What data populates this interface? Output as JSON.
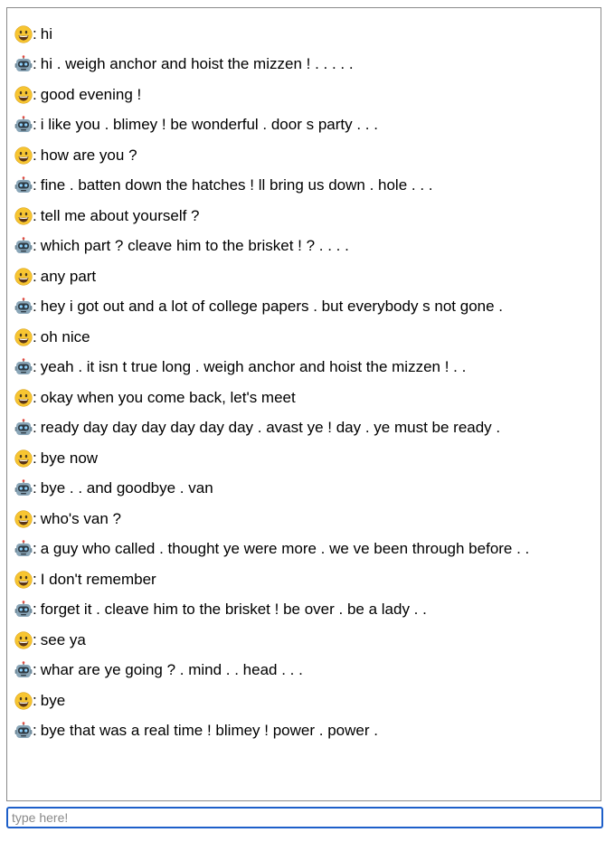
{
  "chat": {
    "separator": ":",
    "messages": [
      {
        "speaker": "user",
        "avatar_icon": "grinning-face-icon",
        "text": "hi"
      },
      {
        "speaker": "bot",
        "avatar_icon": "robot-face-icon",
        "text": "hi . weigh anchor and hoist the mizzen ! . . . . ."
      },
      {
        "speaker": "user",
        "avatar_icon": "grinning-face-icon",
        "text": "good evening !"
      },
      {
        "speaker": "bot",
        "avatar_icon": "robot-face-icon",
        "text": "i like you . blimey ! be wonderful . door s party . . ."
      },
      {
        "speaker": "user",
        "avatar_icon": "grinning-face-icon",
        "text": "how are you ?"
      },
      {
        "speaker": "bot",
        "avatar_icon": "robot-face-icon",
        "text": "fine . batten down the hatches ! ll bring us down . hole . . ."
      },
      {
        "speaker": "user",
        "avatar_icon": "grinning-face-icon",
        "text": "tell me about yourself ?"
      },
      {
        "speaker": "bot",
        "avatar_icon": "robot-face-icon",
        "text": "which part ? cleave him to the brisket ! ? . . . ."
      },
      {
        "speaker": "user",
        "avatar_icon": "grinning-face-icon",
        "text": "any part"
      },
      {
        "speaker": "bot",
        "avatar_icon": "robot-face-icon",
        "text": "hey i got out and a lot of college papers . but everybody s not gone ."
      },
      {
        "speaker": "user",
        "avatar_icon": "grinning-face-icon",
        "text": "oh nice"
      },
      {
        "speaker": "bot",
        "avatar_icon": "robot-face-icon",
        "text": "yeah . it isn t true long . weigh anchor and hoist the mizzen ! . ."
      },
      {
        "speaker": "user",
        "avatar_icon": "grinning-face-icon",
        "text": "okay when you come back, let's meet"
      },
      {
        "speaker": "bot",
        "avatar_icon": "robot-face-icon",
        "text": "ready day day day day day day . avast ye ! day . ye must be ready ."
      },
      {
        "speaker": "user",
        "avatar_icon": "grinning-face-icon",
        "text": "bye now"
      },
      {
        "speaker": "bot",
        "avatar_icon": "robot-face-icon",
        "text": "bye . . and goodbye . van"
      },
      {
        "speaker": "user",
        "avatar_icon": "grinning-face-icon",
        "text": "who's van ?"
      },
      {
        "speaker": "bot",
        "avatar_icon": "robot-face-icon",
        "text": "a guy who called . thought ye were more . we ve been through before . ."
      },
      {
        "speaker": "user",
        "avatar_icon": "grinning-face-icon",
        "text": "I don't remember"
      },
      {
        "speaker": "bot",
        "avatar_icon": "robot-face-icon",
        "text": "forget it . cleave him to the brisket ! be over . be a lady . ."
      },
      {
        "speaker": "user",
        "avatar_icon": "grinning-face-icon",
        "text": "see ya"
      },
      {
        "speaker": "bot",
        "avatar_icon": "robot-face-icon",
        "text": "whar are ye going ? . mind . . head . . ."
      },
      {
        "speaker": "user",
        "avatar_icon": "grinning-face-icon",
        "text": "bye"
      },
      {
        "speaker": "bot",
        "avatar_icon": "robot-face-icon",
        "text": "bye that was a real time ! blimey ! power . power ."
      }
    ]
  },
  "input": {
    "placeholder": "type here!",
    "value": ""
  },
  "colors": {
    "border": "#8a8a8a",
    "input_focus_border": "#1d5fc9",
    "user_face": "#f7c531",
    "bot_face": "#8aa6b8"
  }
}
